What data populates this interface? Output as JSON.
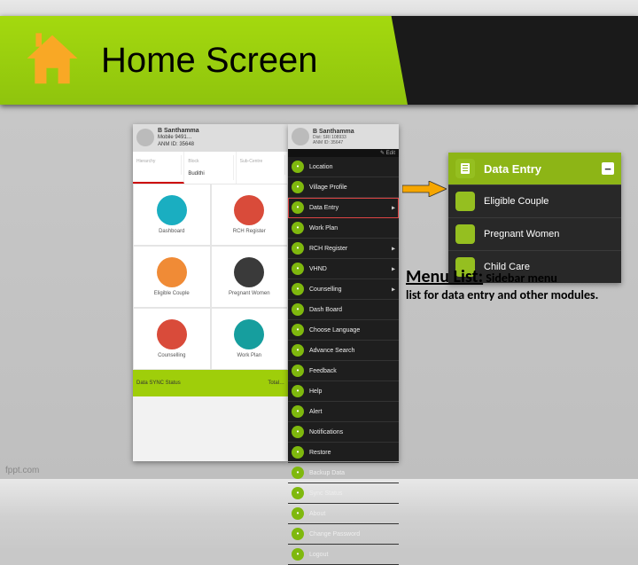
{
  "banner": {
    "title": "Home Screen"
  },
  "callout": {
    "lead": "Menu List:",
    "tail": " Sidebar menu",
    "body": "list for data entry and other modules."
  },
  "phoneA": {
    "user": {
      "name": "B Santhamma",
      "mobile": "Mobile  9491…",
      "anm": "ANM ID: 35648"
    },
    "crumbs": [
      {
        "lbl": "Hierarchy",
        "val": ""
      },
      {
        "lbl": "Block",
        "val": "Budithi"
      },
      {
        "lbl": "Sub-Centre",
        "val": ""
      }
    ],
    "cells": [
      {
        "cap": "Dashboard",
        "cls": "ic-teal"
      },
      {
        "cap": "RCH Register",
        "cls": "ic-red"
      },
      {
        "cap": "Eligible Couple",
        "cls": "ic-orange"
      },
      {
        "cap": "Pregnant Women",
        "cls": "ic-dark"
      },
      {
        "cap": "Counselling",
        "cls": "ic-red"
      },
      {
        "cap": "Work Plan",
        "cls": "ic-teal2"
      }
    ],
    "footer": {
      "left": "Data SYNC Status",
      "right": "Total…"
    }
  },
  "phoneB": {
    "user": {
      "name": "B Santhamma",
      "sub1": "Dist: SRI 108933",
      "sub2": "ANM ID: 35647"
    },
    "edit": "✎ Edit",
    "items": [
      {
        "label": "Location",
        "plus": false
      },
      {
        "label": "Village Profile",
        "plus": false
      },
      {
        "label": "Data Entry",
        "plus": true,
        "hl": true
      },
      {
        "label": "Work Plan",
        "plus": false
      },
      {
        "label": "RCH Register",
        "plus": true
      },
      {
        "label": "VHND",
        "plus": true
      },
      {
        "label": "Counselling",
        "plus": true
      },
      {
        "label": "Dash Board",
        "plus": false
      },
      {
        "label": "Choose Language",
        "plus": false
      },
      {
        "label": "Advance Search",
        "plus": false
      },
      {
        "label": "Feedback",
        "plus": false
      },
      {
        "label": "Help",
        "plus": false
      },
      {
        "label": "Alert",
        "plus": false
      },
      {
        "label": "Notifications",
        "plus": false
      },
      {
        "label": "Restore",
        "plus": false
      },
      {
        "label": "Backup Data",
        "plus": false
      },
      {
        "label": "Sync Status",
        "plus": false
      },
      {
        "label": "About",
        "plus": false
      },
      {
        "label": "Change Password",
        "plus": false
      },
      {
        "label": "Logout",
        "plus": false
      }
    ]
  },
  "popout": {
    "head": "Data Entry",
    "items": [
      "Eligible Couple",
      "Pregnant Women",
      "Child Care"
    ]
  },
  "credit": "fppt.com"
}
